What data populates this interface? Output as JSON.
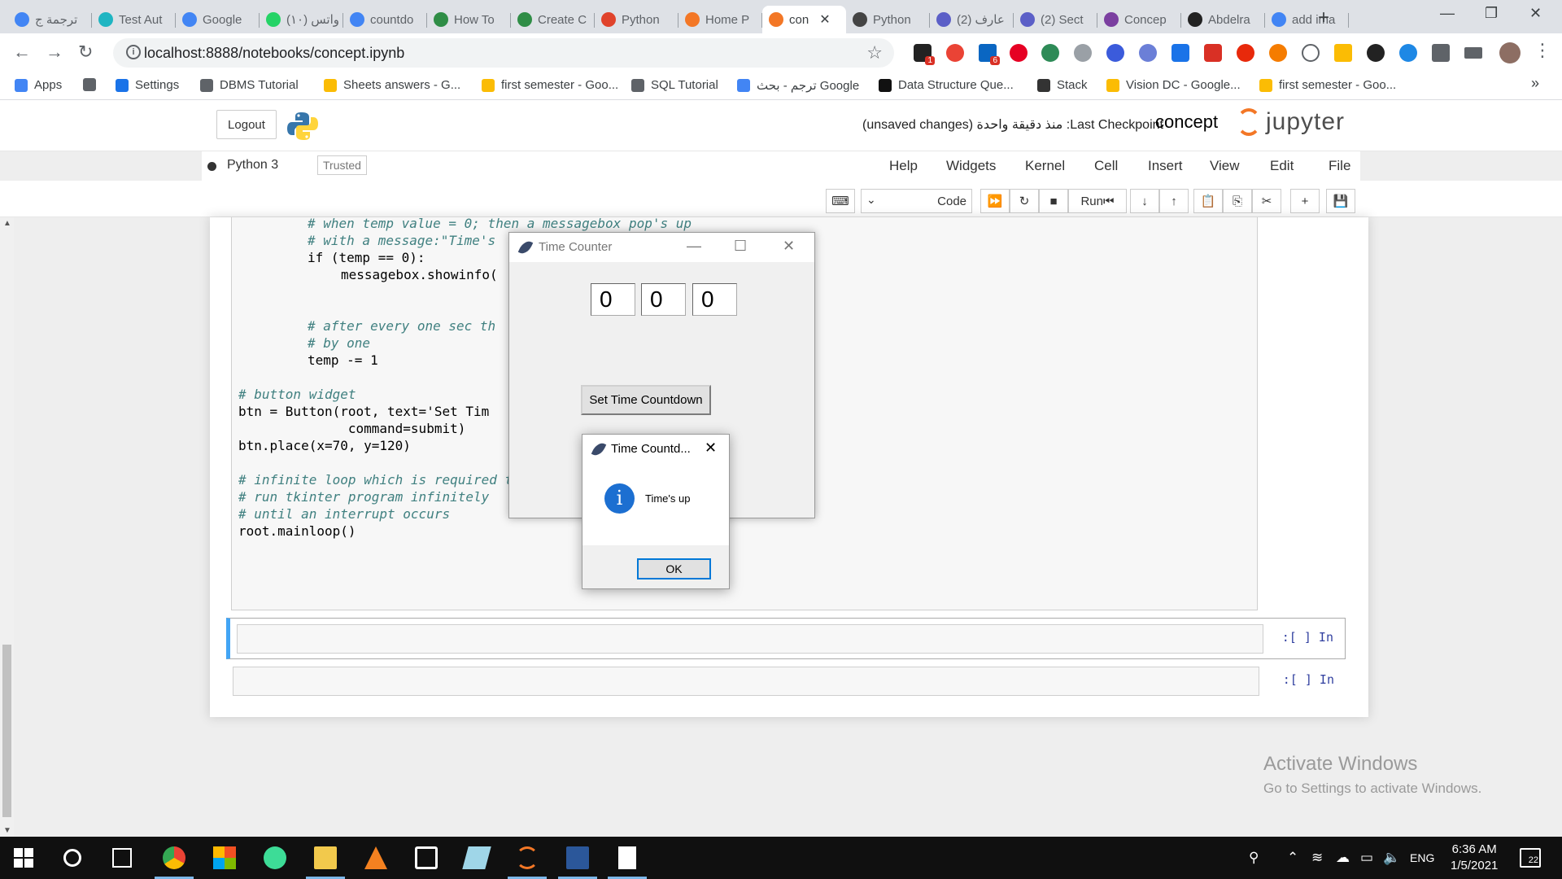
{
  "browser": {
    "tabs": [
      {
        "label": "ترجمة ج",
        "icon": "google-icon",
        "color": "#4285f4"
      },
      {
        "label": "Test Aut",
        "icon": "hexagon-icon",
        "color": "#1fb5c2"
      },
      {
        "label": "Google",
        "icon": "google-icon",
        "color": "#4285f4"
      },
      {
        "label": "(١٠) واتس",
        "icon": "whatsapp-badge-icon",
        "color": "#25d366"
      },
      {
        "label": "countdo",
        "icon": "google-icon",
        "color": "#4285f4"
      },
      {
        "label": "How To",
        "icon": "geeksforgeeks-icon",
        "color": "#2f8d46"
      },
      {
        "label": "Create C",
        "icon": "geeksforgeeks-icon",
        "color": "#2f8d46"
      },
      {
        "label": "Python",
        "icon": "python-red-icon",
        "color": "#e0432b"
      },
      {
        "label": "Home P",
        "icon": "jupyter-icon",
        "color": "#f37726"
      },
      {
        "label": "con",
        "icon": "hourglass-icon",
        "color": "#f37726",
        "active": true
      },
      {
        "label": "Python",
        "icon": "diamond-icon",
        "color": "#444444"
      },
      {
        "label": "(2) عارف",
        "icon": "teams-icon",
        "color": "#5b5fc7"
      },
      {
        "label": "(2) Sect",
        "icon": "teams-icon",
        "color": "#5b5fc7"
      },
      {
        "label": "Concep",
        "icon": "forms-icon",
        "color": "#7b3fa0"
      },
      {
        "label": "Abdelra",
        "icon": "github-icon",
        "color": "#222222"
      },
      {
        "label": "add ima",
        "icon": "google-icon",
        "color": "#4285f4"
      }
    ],
    "url": "localhost:8888/notebooks/concept.ipynb",
    "bookmarks": [
      {
        "label": "Apps",
        "icon": "apps-grid-icon",
        "color": "#4285f4"
      },
      {
        "label": "",
        "icon": "globe-icon",
        "color": "#5f6368"
      },
      {
        "label": "Settings",
        "icon": "gear-icon",
        "color": "#1a73e8"
      },
      {
        "label": "DBMS Tutorial",
        "icon": "diamond-icon",
        "color": "#5f6368"
      },
      {
        "label": "Sheets answers - G...",
        "icon": "drive-icon",
        "color": "#fbbc04"
      },
      {
        "label": "first semester - Goo...",
        "icon": "drive-icon",
        "color": "#fbbc04"
      },
      {
        "label": "SQL Tutorial",
        "icon": "diamond-icon",
        "color": "#5f6368"
      },
      {
        "label": "ترجم - بحث Google",
        "icon": "google-icon",
        "color": "#4285f4"
      },
      {
        "label": "Data Structure Que...",
        "icon": "sf-icon",
        "color": "#111111"
      },
      {
        "label": "Stack",
        "icon": "stack-icon",
        "color": "#333333"
      },
      {
        "label": "Vision DC - Google...",
        "icon": "drive-icon",
        "color": "#fbbc04"
      },
      {
        "label": "first semester - Goo...",
        "icon": "drive-icon",
        "color": "#fbbc04"
      }
    ],
    "ext_badges": {
      "first": "1",
      "second": "6"
    }
  },
  "jupyter": {
    "logout_label": "Logout",
    "checkpoint_text": "(unsaved changes)  منذ دقيقة واحدة :Last Checkpoint",
    "notebook_name": "concept",
    "brand": "jupyter",
    "kernel_name": "Python 3",
    "trusted_label": "Trusted",
    "menus": [
      "Help",
      "Widgets",
      "Kernel",
      "Cell",
      "Insert",
      "View",
      "Edit",
      "File"
    ],
    "toolbar": {
      "run_label": "Run",
      "cell_type": "Code"
    },
    "prompt": ":[ ] In"
  },
  "code_lines": [
    {
      "t": "# when temp value = 0; then a messagebox pop's up",
      "c": "comment",
      "indent": 2
    },
    {
      "t": "# with a message:\"Time's",
      "c": "comment",
      "indent": 2
    },
    {
      "t": "if (temp == 0):",
      "c": "if",
      "indent": 2
    },
    {
      "t": "messagebox.showinfo(",
      "c": "plain",
      "indent": 3
    },
    {
      "t": "",
      "c": "plain",
      "indent": 0
    },
    {
      "t": "",
      "c": "plain",
      "indent": 0
    },
    {
      "t": "# after every one sec th",
      "c": "comment",
      "indent": 2
    },
    {
      "t": "# by one",
      "c": "comment",
      "indent": 2
    },
    {
      "t": "temp -= 1",
      "c": "dec",
      "indent": 2
    },
    {
      "t": "",
      "c": "plain",
      "indent": 0
    },
    {
      "t": "# button widget",
      "c": "comment",
      "indent": 0
    },
    {
      "t": "btn = Button(root, text='Set Tim",
      "c": "btn",
      "indent": 0
    },
    {
      "t": "              command=submit)",
      "c": "plain",
      "indent": 0
    },
    {
      "t": "btn.place(x=70, y=120)",
      "c": "place",
      "indent": 0
    },
    {
      "t": "",
      "c": "plain",
      "indent": 0
    },
    {
      "t": "# infinite loop which is required to",
      "c": "comment",
      "indent": 0
    },
    {
      "t": "# run tkinter program infinitely",
      "c": "comment",
      "indent": 0
    },
    {
      "t": "# until an interrupt occurs",
      "c": "comment",
      "indent": 0
    },
    {
      "t": "root.mainloop()",
      "c": "plain",
      "indent": 0
    }
  ],
  "tk_window": {
    "title": "Time Counter",
    "digits": [
      "0",
      "0",
      "0"
    ],
    "button_label": "Set Time Countdown"
  },
  "messagebox": {
    "title": "Time Countd...",
    "message": "Time's up",
    "ok_label": "OK"
  },
  "watermark": {
    "line1": "Activate Windows",
    "line2": "Go to Settings to activate Windows."
  },
  "taskbar": {
    "language": "ENG",
    "time": "6:36 AM",
    "date": "1/5/2021",
    "notification_count": "22"
  },
  "colors": {
    "jupyter_orange": "#f37726",
    "selected_cell": "#42a5f5",
    "prompt_blue": "#303f9f",
    "taskbar": "#101010"
  }
}
